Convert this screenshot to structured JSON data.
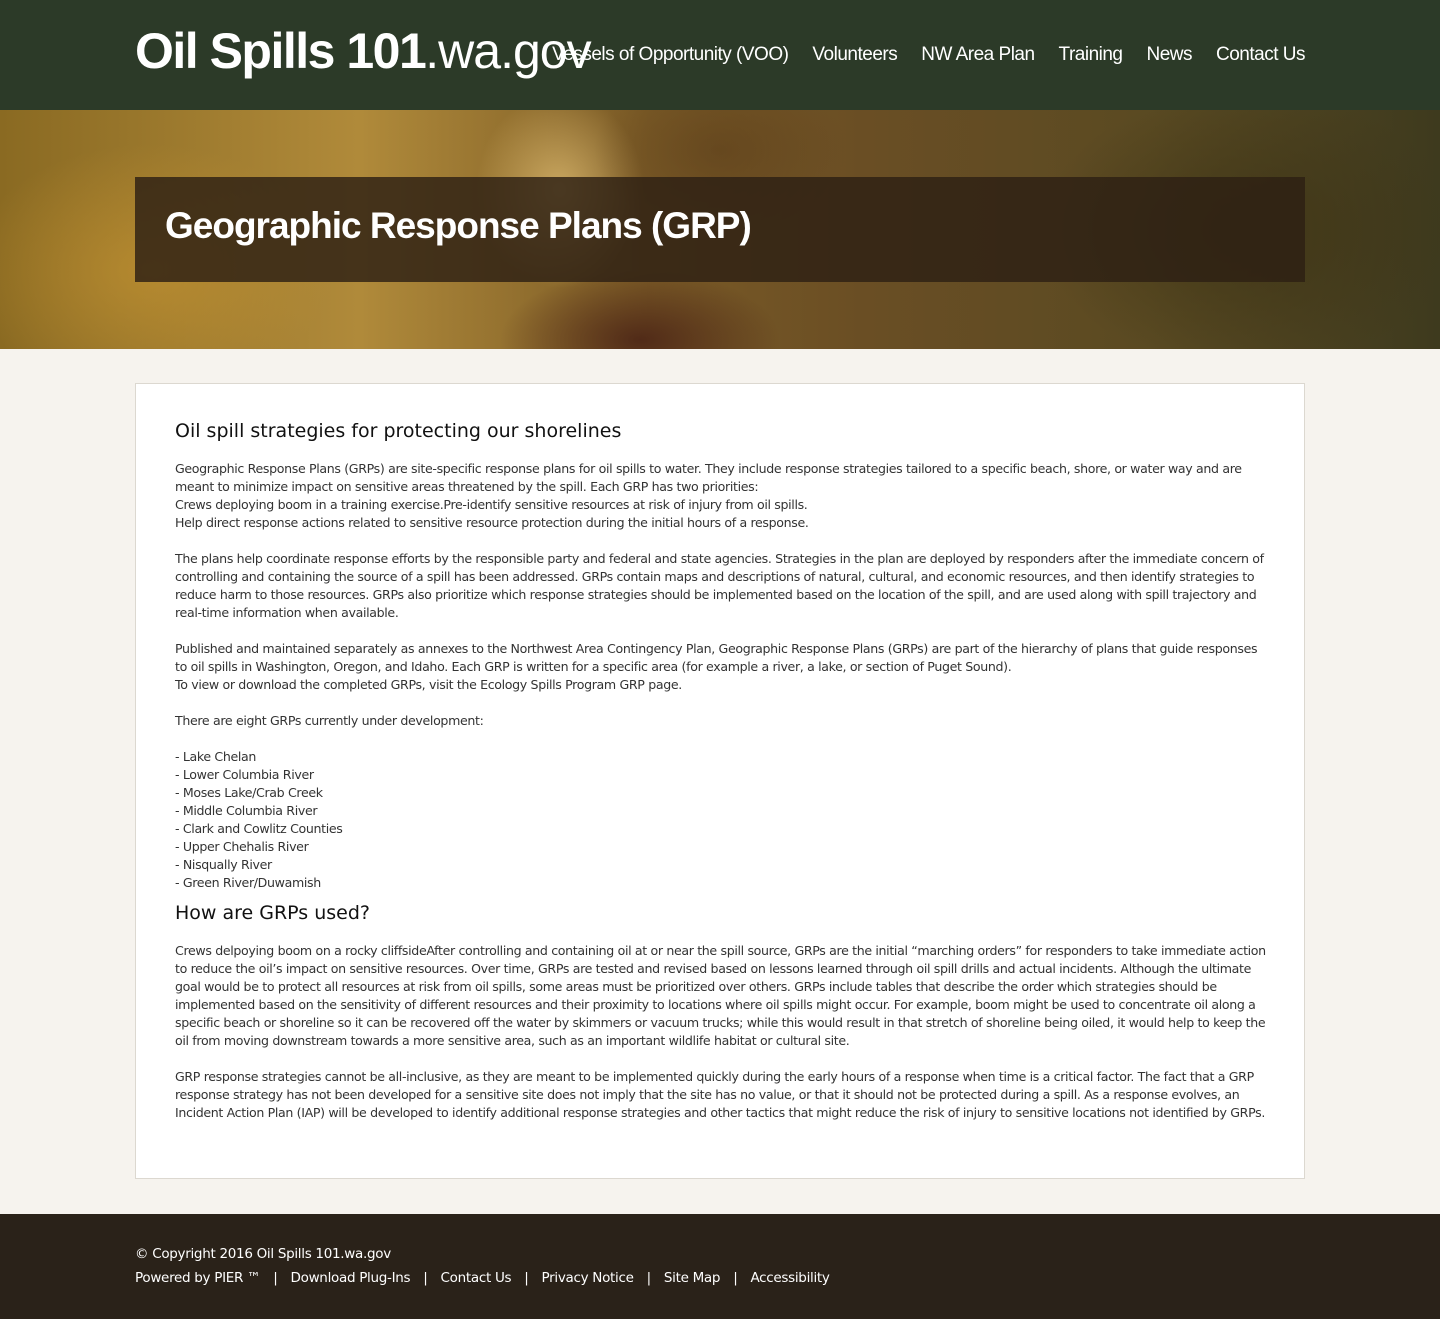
{
  "header": {
    "brand_main": "Oil Spills 101",
    "brand_suffix": ".wa.gov",
    "nav": [
      "Vessels of Opportunity (VOO)",
      "Volunteers",
      "NW Area Plan",
      "Training",
      "News",
      "Contact Us"
    ]
  },
  "hero": {
    "title": "Geographic Response Plans (GRP)"
  },
  "content": {
    "heading1": "Oil spill strategies for protecting our shorelines",
    "p1": "Geographic Response Plans (GRPs) are site-specific response plans for oil spills to water. They include response strategies tailored to a specific beach, shore, or water way and are meant to minimize impact on sensitive areas threatened by the spill. Each GRP has two priorities:\nCrews deploying boom in a training exercise.Pre-identify sensitive resources at risk of injury from oil spills.\nHelp direct response actions related to sensitive resource protection during the initial hours of a response.",
    "p2": "The plans help coordinate response efforts by the responsible party and federal and state agencies. Strategies in the plan are deployed by responders after the immediate concern of controlling and containing the source of a spill has been addressed. GRPs contain maps and descriptions of natural, cultural, and economic resources, and then identify strategies to reduce harm to those resources. GRPs also prioritize which response strategies should be implemented based on the location of the spill, and are used along with spill trajectory and real-time information when available.",
    "p3": "Published and maintained separately as annexes to the Northwest Area Contingency Plan, Geographic Response Plans (GRPs) are part of the hierarchy of plans that guide responses to oil spills in Washington, Oregon, and Idaho. Each GRP is written for a specific area (for example a river, a lake, or section of Puget Sound).\nTo view or download the completed GRPs, visit the Ecology Spills Program GRP page.",
    "p4": "There are eight GRPs currently under development:",
    "list": [
      "- Lake Chelan",
      "- Lower Columbia River",
      "- Moses Lake/Crab Creek",
      "- Middle Columbia River",
      "- Clark and Cowlitz Counties",
      "- Upper Chehalis River",
      "- Nisqually River",
      "- Green River/Duwamish"
    ],
    "heading2": "How are GRPs used?",
    "p5": "Crews delpoying boom on a rocky cliffsideAfter controlling and containing oil at or near the spill source, GRPs are the initial “marching orders” for responders to take immediate action to reduce the oil’s impact on sensitive resources. Over time, GRPs are tested and revised based on lessons learned through oil spill drills and actual incidents.  Although the ultimate goal would be to protect all resources at risk from oil spills, some areas must be prioritized over others. GRPs include tables that describe the order which strategies should be implemented based on the sensitivity of different resources and their proximity to locations where oil spills might occur. For example, boom might be used to concentrate oil along a specific beach or shoreline so it can be recovered off the water by skimmers or vacuum trucks; while this would result in that stretch of shoreline being oiled, it would help to keep the oil from moving downstream towards a more sensitive area, such as an important wildlife habitat or cultural site.",
    "p6": "GRP response strategies cannot be all-inclusive, as they are meant to be implemented quickly during the early hours of a response when time is a critical factor. The fact that a GRP response strategy has not been developed for a sensitive site does not imply that the site has no value, or that it should not be protected during a spill. As a response evolves, an Incident Action Plan (IAP) will be developed to identify additional response strategies and other tactics that might reduce the risk of injury to sensitive locations not identified by GRPs."
  },
  "footer": {
    "copyright": "© Copyright 2016 Oil Spills 101.wa.gov",
    "links": [
      "Powered by PIER ™",
      "Download Plug-Ins",
      "Contact Us",
      "Privacy Notice",
      "Site Map",
      "Accessibility"
    ],
    "separator": "|"
  }
}
